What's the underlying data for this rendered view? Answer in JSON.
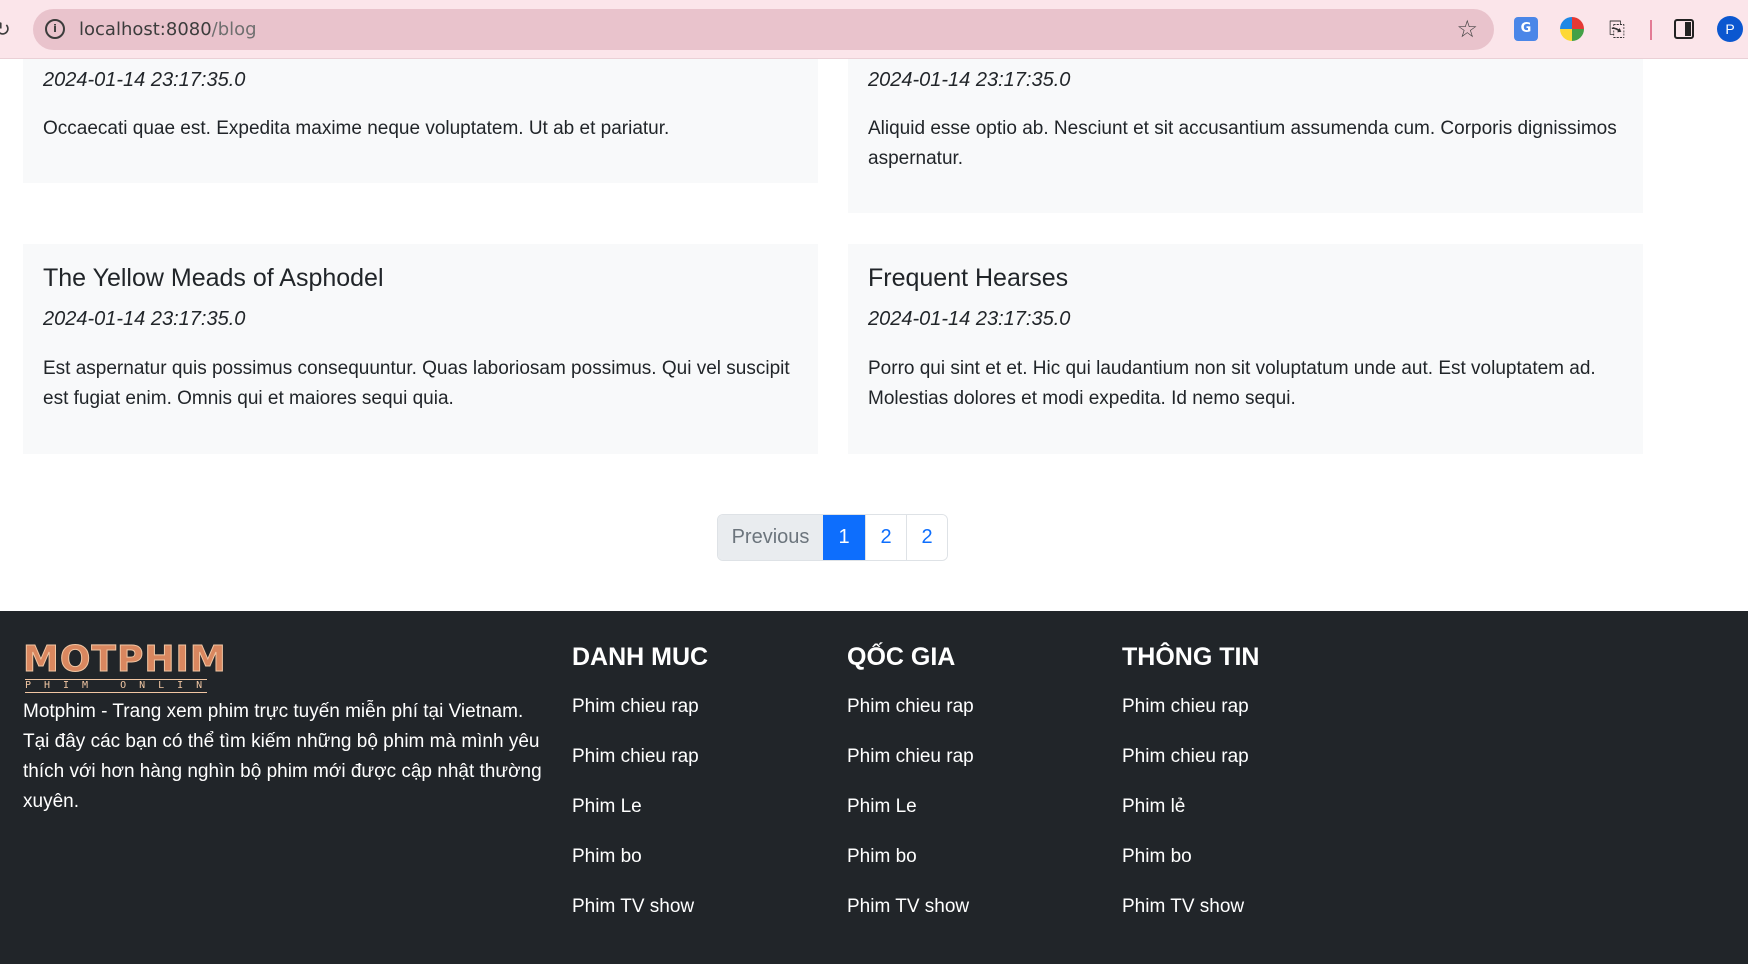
{
  "browser": {
    "url_host": "localhost:8080",
    "url_path": "/blog",
    "profile_initial": "P"
  },
  "posts": [
    {
      "title": "",
      "date": "2024-01-14 23:17:35.0",
      "excerpt": "Occaecati quae est. Expedita maxime neque voluptatem. Ut ab et pariatur."
    },
    {
      "title": "",
      "date": "2024-01-14 23:17:35.0",
      "excerpt": "Aliquid esse optio ab. Nesciunt et sit accusantium assumenda cum. Corporis dignissimos aspernatur."
    },
    {
      "title": "The Yellow Meads of Asphodel",
      "date": "2024-01-14 23:17:35.0",
      "excerpt": "Est aspernatur quis possimus consequuntur. Quas laboriosam possimus. Qui vel suscipit est fugiat enim. Omnis qui et maiores sequi quia."
    },
    {
      "title": "Frequent Hearses",
      "date": "2024-01-14 23:17:35.0",
      "excerpt": "Porro qui sint et et. Hic qui laudantium non sit voluptatum unde aut. Est voluptatem ad. Molestias dolores et modi expedita. Id nemo sequi."
    }
  ],
  "pagination": {
    "previous": "Previous",
    "pages": [
      "1",
      "2",
      "2"
    ],
    "active": "1"
  },
  "footer": {
    "logo_main": "MOTPHIM",
    "logo_sub": "PHIM ONLINE",
    "about": "Motphim - Trang xem phim trực tuyến miễn phí tại Vietnam. Tại đây các bạn có thể tìm kiếm những bộ phim mà mình yêu thích với hơn hàng nghìn bộ phim mới được cập nhật thường xuyên.",
    "columns": [
      {
        "title": "DANH MUC",
        "links": [
          "Phim chieu rap",
          "Phim chieu rap",
          "Phim Le",
          "Phim bo",
          "Phim TV show"
        ]
      },
      {
        "title": "QỐC GIA",
        "links": [
          "Phim chieu rap",
          "Phim chieu rap",
          "Phim Le",
          "Phim bo",
          "Phim TV show"
        ]
      },
      {
        "title": "THÔNG TIN",
        "links": [
          "Phim chieu rap",
          "Phim chieu rap",
          "Phim lẻ",
          "Phim bo",
          "Phim TV show"
        ]
      }
    ]
  }
}
